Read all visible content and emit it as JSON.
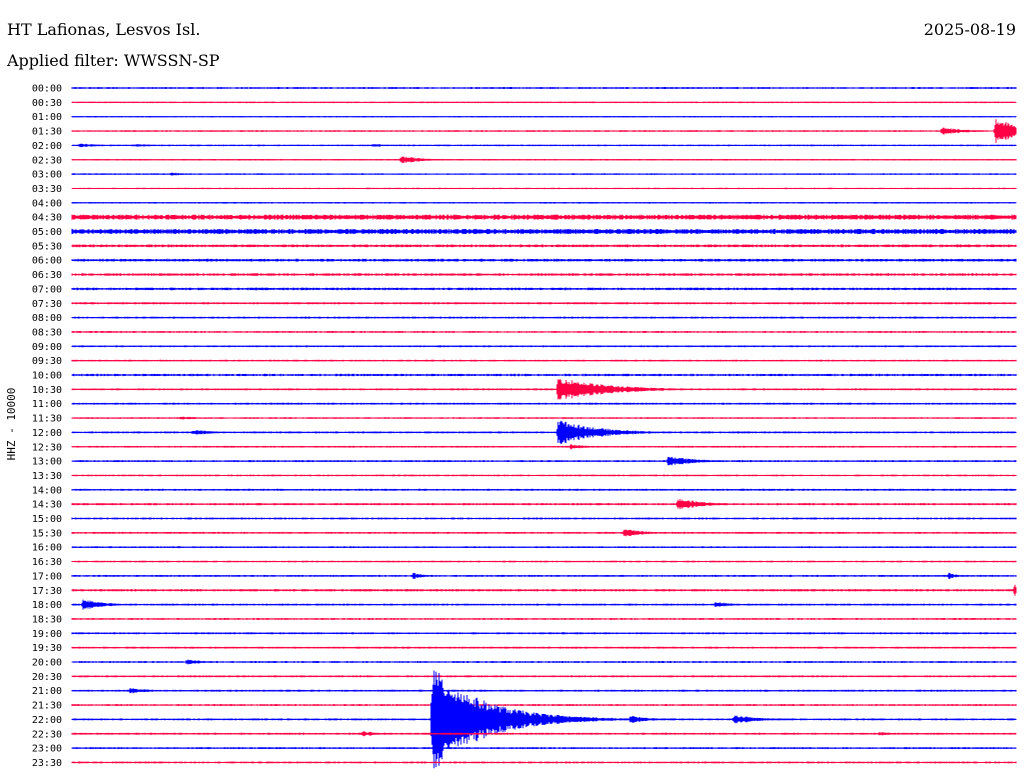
{
  "header": {
    "station": "HT Lafionas, Lesvos Isl.",
    "date": "2025-08-19",
    "filter": "Applied filter: WWSSN-SP"
  },
  "chart_data": {
    "type": "line",
    "ylabel": "HHZ - 10000",
    "x_minutes": [
      0,
      30
    ],
    "colors": [
      "#0000ff",
      "#ff0044"
    ],
    "rows": [
      "00:00",
      "00:30",
      "01:00",
      "01:30",
      "02:00",
      "02:30",
      "03:00",
      "03:30",
      "04:00",
      "04:30",
      "05:00",
      "05:30",
      "06:00",
      "06:30",
      "07:00",
      "07:30",
      "08:00",
      "08:30",
      "09:00",
      "09:30",
      "10:00",
      "10:30",
      "11:00",
      "11:30",
      "12:00",
      "12:30",
      "13:00",
      "13:30",
      "14:00",
      "14:30",
      "15:00",
      "15:30",
      "16:00",
      "16:30",
      "17:00",
      "17:30",
      "18:00",
      "18:30",
      "19:00",
      "19:30",
      "20:00",
      "20:30",
      "21:00",
      "21:30",
      "22:00",
      "22:30",
      "23:00",
      "23:30"
    ],
    "noise": [
      1.0,
      0.8,
      0.7,
      0.9,
      0.8,
      0.8,
      0.8,
      0.7,
      0.8,
      2.6,
      2.6,
      1.4,
      1.4,
      1.3,
      1.3,
      1.1,
      1.0,
      1.0,
      0.9,
      0.9,
      1.2,
      1.0,
      1.0,
      0.9,
      1.0,
      0.9,
      1.0,
      0.9,
      1.0,
      1.1,
      1.0,
      1.0,
      0.9,
      0.9,
      1.0,
      1.2,
      1.0,
      1.0,
      1.0,
      1.0,
      1.0,
      1.0,
      1.0,
      1.0,
      1.0,
      1.0,
      1.0,
      1.0
    ],
    "events": [
      {
        "row": 3,
        "t": 27.6,
        "amp": 4,
        "dur": 0.8
      },
      {
        "row": 3,
        "t": 29.3,
        "amp": 14,
        "dur": 0.9
      },
      {
        "row": 4,
        "t": 0.2,
        "amp": 2,
        "dur": 0.8
      },
      {
        "row": 4,
        "t": 2.0,
        "amp": 2,
        "dur": 0.6
      },
      {
        "row": 4,
        "t": 9.5,
        "amp": 2,
        "dur": 0.6
      },
      {
        "row": 5,
        "t": 10.4,
        "amp": 4,
        "dur": 0.8
      },
      {
        "row": 6,
        "t": 3.1,
        "amp": 2,
        "dur": 0.5
      },
      {
        "row": 21,
        "t": 15.4,
        "amp": 13,
        "dur": 1.5
      },
      {
        "row": 23,
        "t": 3.4,
        "amp": 2,
        "dur": 0.8
      },
      {
        "row": 24,
        "t": 3.8,
        "amp": 3,
        "dur": 0.7
      },
      {
        "row": 24,
        "t": 15.4,
        "amp": 14,
        "dur": 1.2
      },
      {
        "row": 25,
        "t": 15.8,
        "amp": 3,
        "dur": 0.6
      },
      {
        "row": 26,
        "t": 18.9,
        "amp": 6,
        "dur": 0.8
      },
      {
        "row": 29,
        "t": 19.2,
        "amp": 6,
        "dur": 0.9
      },
      {
        "row": 31,
        "t": 17.5,
        "amp": 5,
        "dur": 0.6
      },
      {
        "row": 34,
        "t": 10.8,
        "amp": 4,
        "dur": 0.3
      },
      {
        "row": 34,
        "t": 27.8,
        "amp": 4,
        "dur": 0.3
      },
      {
        "row": 35,
        "t": 29.9,
        "amp": 7,
        "dur": 0.4
      },
      {
        "row": 36,
        "t": 0.3,
        "amp": 6,
        "dur": 0.7
      },
      {
        "row": 36,
        "t": 20.4,
        "amp": 3,
        "dur": 0.7
      },
      {
        "row": 40,
        "t": 3.6,
        "amp": 3,
        "dur": 0.6
      },
      {
        "row": 42,
        "t": 1.8,
        "amp": 3,
        "dur": 0.7
      },
      {
        "row": 44,
        "t": 11.4,
        "amp": 55,
        "dur": 1.6
      },
      {
        "row": 44,
        "t": 15.4,
        "amp": 5,
        "dur": 0.8
      },
      {
        "row": 44,
        "t": 17.7,
        "amp": 4,
        "dur": 0.7
      },
      {
        "row": 44,
        "t": 21.0,
        "amp": 5,
        "dur": 0.8
      },
      {
        "row": 45,
        "t": 9.2,
        "amp": 3,
        "dur": 0.6
      },
      {
        "row": 45,
        "t": 25.6,
        "amp": 2,
        "dur": 0.6
      }
    ]
  }
}
